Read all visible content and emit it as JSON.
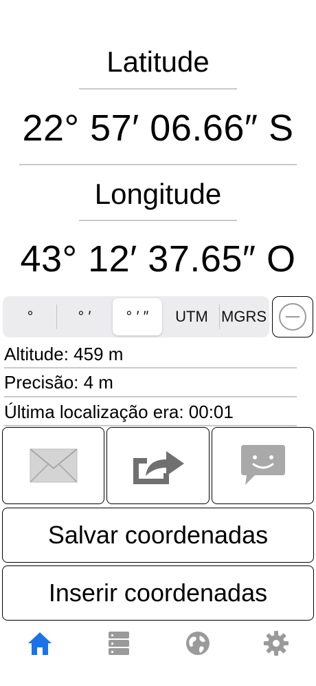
{
  "coords": {
    "latitude_label": "Latitude",
    "latitude_value": "22° 57′ 06.66″ S",
    "longitude_label": "Longitude",
    "longitude_value": "43° 12′ 37.65″ O"
  },
  "format_selector": {
    "options": [
      "°",
      "° ′",
      "° ′ ″",
      "UTM",
      "MGRS"
    ],
    "selected": "° ′ ″"
  },
  "info": {
    "altitude": "Altitude: 459 m",
    "precision": "Precisão: 4 m",
    "last_location": "Última localização era: 00:01"
  },
  "actions": {
    "save_label": "Salvar coordenadas",
    "insert_label": "Inserir coordenadas"
  },
  "icons": {
    "email": "envelope-icon",
    "share": "share-icon",
    "message": "chat-bubble-icon",
    "remove": "minus-circle-icon"
  },
  "tabbar": {
    "items": [
      "home-icon",
      "list-icon",
      "globe-icon",
      "gear-icon"
    ],
    "active": "home-icon",
    "active_color": "#1a73e8",
    "inactive_color": "#9a9a9a"
  }
}
